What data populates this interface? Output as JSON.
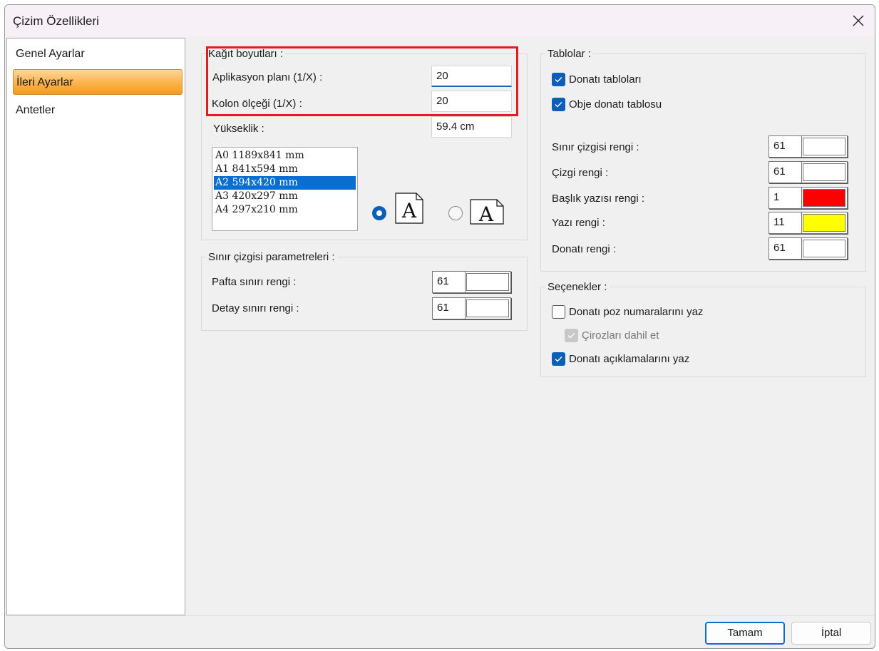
{
  "window": {
    "title": "Çizim Özellikleri"
  },
  "nav": {
    "items": [
      {
        "label": "Genel Ayarlar"
      },
      {
        "label": "İleri Ayarlar"
      },
      {
        "label": "Antetler"
      }
    ]
  },
  "paper": {
    "title": "Kağıt boyutları :",
    "app_plan_label": "Aplikasyon planı (1/X) :",
    "app_plan_value": "20",
    "column_scale_label": "Kolon ölçeği (1/X) :",
    "column_scale_value": "20",
    "height_label": "Yükseklik :",
    "height_value": "59.4 cm",
    "sizes": [
      "A0 1189x841 mm",
      "A1 841x594 mm",
      "A2 594x420 mm",
      "A3 420x297 mm",
      "A4 297x210 mm"
    ],
    "selected_size": "A2 594x420 mm",
    "orientation": "portrait",
    "orientation_glyph": "A"
  },
  "border_params": {
    "title": "Sınır çizgisi parametreleri :",
    "sheet_label": "Pafta sınırı rengi :",
    "sheet_value": "61",
    "detail_label": "Detay sınırı rengi :",
    "detail_value": "61"
  },
  "tables": {
    "title": "Tablolar :",
    "rebar_tables_label": "Donatı tabloları",
    "rebar_tables_checked": true,
    "object_table_label": "Obje donatı tablosu",
    "object_table_checked": true,
    "colors": [
      {
        "label": "Sınır çizgisi rengi :",
        "value": "61",
        "swatch": "#ffffff"
      },
      {
        "label": "Çizgi rengi :",
        "value": "61",
        "swatch": "#ffffff"
      },
      {
        "label": "Başlık yazısı rengi :",
        "value": "1",
        "swatch": "#ff0000"
      },
      {
        "label": "Yazı rengi :",
        "value": "11",
        "swatch": "#ffff00"
      },
      {
        "label": "Donatı rengi :",
        "value": "61",
        "swatch": "#ffffff"
      }
    ]
  },
  "options": {
    "title": "Seçenekler :",
    "items": [
      {
        "label": "Donatı poz numaralarını yaz",
        "checked": false,
        "disabled": false
      },
      {
        "label": "Çirozları dahil et",
        "checked": true,
        "disabled": true
      },
      {
        "label": "Donatı açıklamalarını yaz",
        "checked": true,
        "disabled": false
      }
    ]
  },
  "buttons": {
    "ok": "Tamam",
    "cancel": "İptal"
  },
  "colors": {
    "accent": "#0c5fb8",
    "highlight": "#e31b23",
    "nav_selected": "#fbb24a"
  }
}
